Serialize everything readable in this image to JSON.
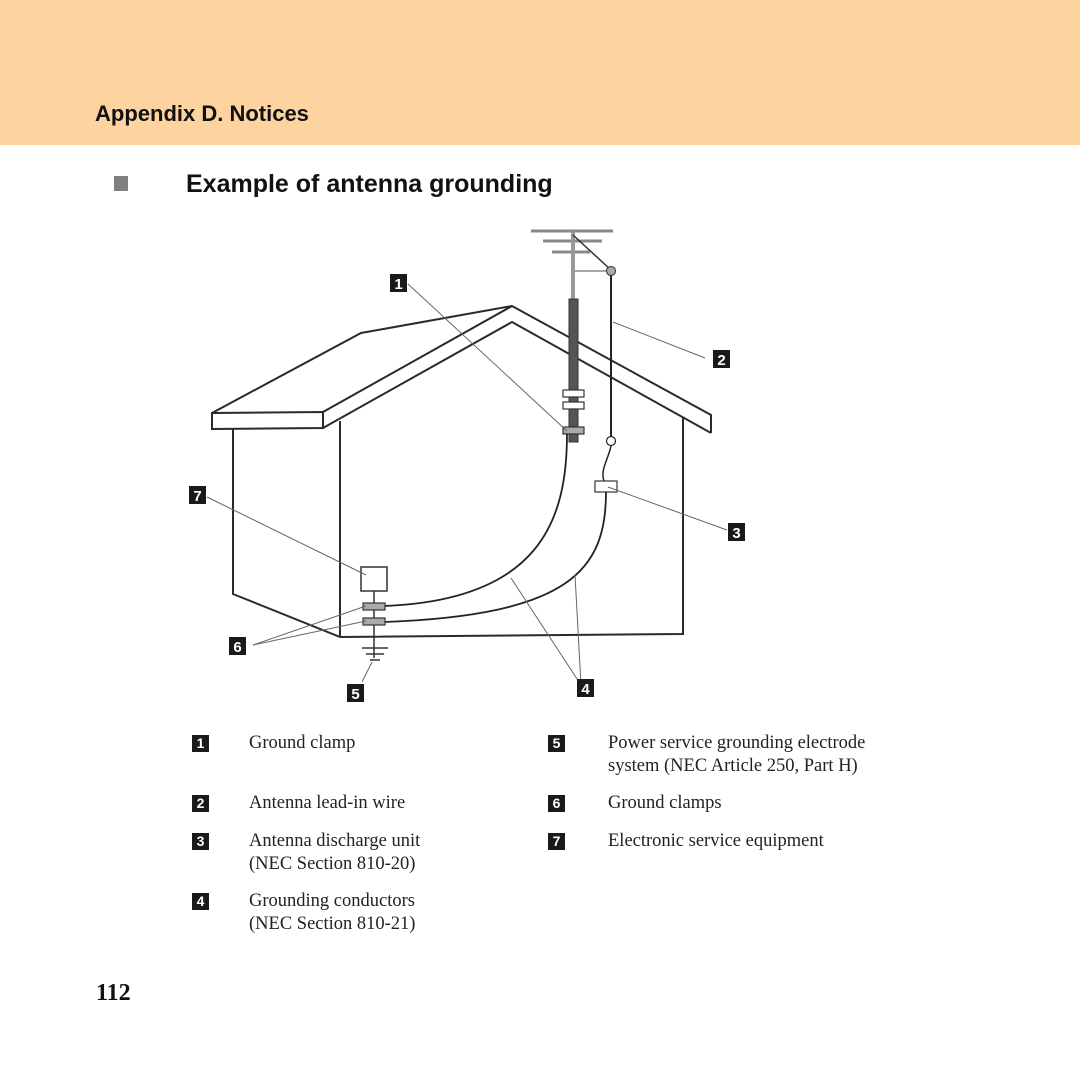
{
  "header": {
    "title": "Appendix D. Notices",
    "band_color": "#fdd3a0"
  },
  "section": {
    "title": "Example of antenna grounding",
    "bullet_icon": "square-bullet-icon"
  },
  "diagram": {
    "callouts": [
      "1",
      "2",
      "3",
      "4",
      "5",
      "6",
      "7"
    ]
  },
  "legend": [
    {
      "num": "1",
      "lines": [
        "Ground clamp"
      ]
    },
    {
      "num": "2",
      "lines": [
        "Antenna lead-in wire"
      ]
    },
    {
      "num": "3",
      "lines": [
        "Antenna discharge unit",
        "(NEC Section 810-20)"
      ]
    },
    {
      "num": "4",
      "lines": [
        "Grounding conductors",
        "(NEC Section 810-21)"
      ]
    },
    {
      "num": "5",
      "lines": [
        "Power service grounding electrode",
        "system (NEC Article 250, Part H)"
      ]
    },
    {
      "num": "6",
      "lines": [
        "Ground clamps"
      ]
    },
    {
      "num": "7",
      "lines": [
        "Electronic service equipment"
      ]
    }
  ],
  "footer": {
    "page_number": "112"
  }
}
